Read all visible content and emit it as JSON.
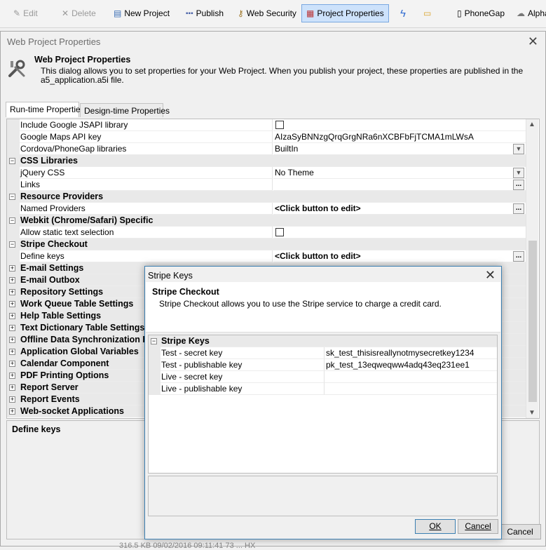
{
  "toolbar": {
    "edit": "Edit",
    "delete": "Delete",
    "new_project": "New Project",
    "publish": "Publish",
    "web_security": "Web Security",
    "project_properties": "Project Properties",
    "phonegap": "PhoneGap",
    "alpha": "Alpha"
  },
  "window": {
    "title": "Web Project Properties",
    "header_title": "Web Project Properties",
    "header_desc": "This dialog allows you to set properties for your Web Project. When you publish your project, these properties are published in the a5_application.a5i file.",
    "tabs": [
      "Run-time Properties",
      "Design-time Properties"
    ],
    "description_title": "Define keys",
    "cancel_label": "Cancel"
  },
  "grid_rows": [
    {
      "name": "Include Google JSAPI library",
      "value": "",
      "kind": "checkbox"
    },
    {
      "name": "Google Maps API key",
      "value": "AIzaSyBNNzgQrqGrgNRa6nXCBFbFjTCMA1mLWsA",
      "kind": "text"
    },
    {
      "name": "Cordova/PhoneGap libraries",
      "value": "BuiltIn",
      "kind": "dropdown"
    },
    {
      "name": "CSS Libraries",
      "kind": "category",
      "toggle": "−"
    },
    {
      "name": "jQuery CSS",
      "value": "No Theme",
      "kind": "dropdown"
    },
    {
      "name": "Links",
      "value": "",
      "kind": "ellipsis"
    },
    {
      "name": "Resource Providers",
      "kind": "category",
      "toggle": "−"
    },
    {
      "name": "Named Providers",
      "value": "<Click button to edit>",
      "kind": "ellipsis-bold"
    },
    {
      "name": "Webkit (Chrome/Safari) Specific",
      "kind": "category",
      "toggle": "−"
    },
    {
      "name": "Allow static text selection",
      "value": "",
      "kind": "checkbox"
    },
    {
      "name": "Stripe Checkout",
      "kind": "category",
      "toggle": "−"
    },
    {
      "name": "Define keys",
      "value": "<Click button to edit>",
      "kind": "ellipsis-bold"
    },
    {
      "name": "E-mail Settings",
      "kind": "category",
      "toggle": "+"
    },
    {
      "name": "E-mail Outbox",
      "kind": "category",
      "toggle": "+"
    },
    {
      "name": "Repository Settings",
      "kind": "category",
      "toggle": "+"
    },
    {
      "name": "Work Queue Table Settings",
      "kind": "category",
      "toggle": "+"
    },
    {
      "name": "Help Table Settings",
      "kind": "category",
      "toggle": "+"
    },
    {
      "name": "Text Dictionary Table Settings",
      "kind": "category",
      "toggle": "+"
    },
    {
      "name": "Offline Data Synchronization Lo",
      "kind": "category",
      "toggle": "+"
    },
    {
      "name": "Application Global Variables",
      "kind": "category",
      "toggle": "+"
    },
    {
      "name": "Calendar Component",
      "kind": "category",
      "toggle": "+"
    },
    {
      "name": "PDF Printing Options",
      "kind": "category",
      "toggle": "+"
    },
    {
      "name": "Report Server",
      "kind": "category",
      "toggle": "+"
    },
    {
      "name": "Report Events",
      "kind": "category",
      "toggle": "+"
    },
    {
      "name": "Web-socket Applications",
      "kind": "category",
      "toggle": "+"
    }
  ],
  "status": "316.5 KB   09/02/2016 09:11:41 73   ...   HX",
  "modal": {
    "title": "Stripe Keys",
    "header_title": "Stripe Checkout",
    "header_desc": "Stripe Checkout allows you to use the Stripe service to charge a credit card.",
    "category": "Stripe Keys",
    "rows": [
      {
        "name": "Test - secret key",
        "value": "sk_test_thisisreallynotmysecretkey1234"
      },
      {
        "name": "Test - publishable key",
        "value": "pk_test_13eqweqww4adq43eq231ee1"
      },
      {
        "name": "Live - secret key",
        "value": ""
      },
      {
        "name": "Live - publishable key",
        "value": ""
      }
    ],
    "ok_label": "OK",
    "cancel_label": "Cancel"
  }
}
